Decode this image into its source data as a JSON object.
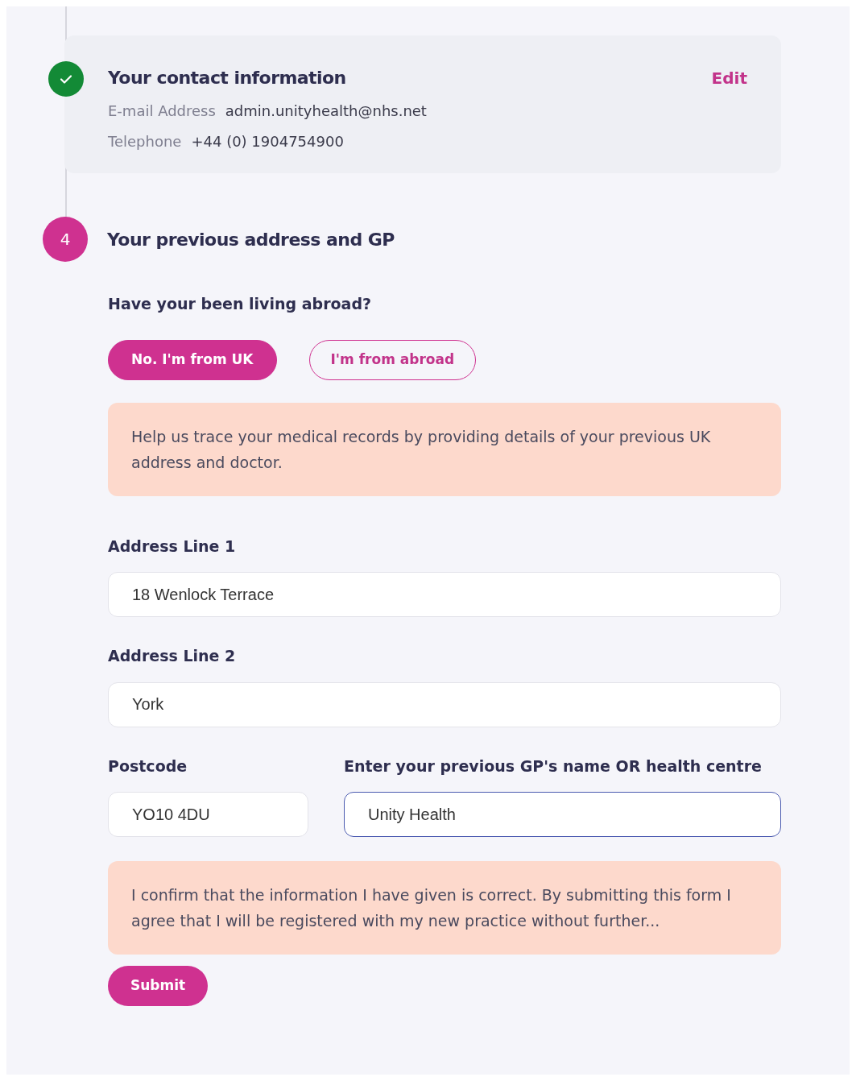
{
  "steps": [
    {
      "kind": "done",
      "title": "Your contact information",
      "action": "Edit",
      "details": [
        {
          "label": "E-mail Address",
          "value": "admin.unityhealth@nhs.net"
        },
        {
          "label": "Telephone",
          "value": "+44 (0) 1904754900"
        }
      ]
    },
    {
      "kind": "current",
      "number": "4",
      "title": "Your previous address and GP"
    }
  ],
  "question": "Have your been living abroad?",
  "options": [
    {
      "label": "No. I'm from UK",
      "selected": true
    },
    {
      "label": "I'm from abroad",
      "selected": false
    }
  ],
  "info_note": "Help us trace your medical records by providing details of your previous UK address and doctor.",
  "fields": [
    {
      "label": "Address Line 1",
      "value": "18 Wenlock Terrace",
      "focused": false,
      "kind": "full"
    },
    {
      "label": "Address Line 2",
      "value": "York",
      "focused": false,
      "kind": "full"
    },
    {
      "label": "Postcode",
      "value": "YO10 4DU",
      "focused": false,
      "kind": "short"
    },
    {
      "label": "Enter your previous GP's name OR health centre",
      "value": "Unity Health",
      "focused": true,
      "kind": "long"
    }
  ],
  "confirm_note": "I confirm that the information I have given is correct. By submitting this form I agree that I will be registered with my new practice without further...",
  "submit": "Submit"
}
